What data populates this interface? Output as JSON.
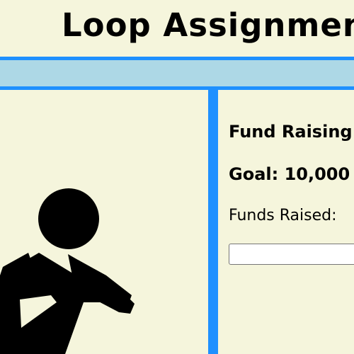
{
  "header": {
    "title": "Loop Assignment"
  },
  "fundraiser": {
    "section_title": "Fund Raising",
    "goal_text": "Goal: 10,000",
    "funds_label": "Funds Raised:",
    "funds_value": ""
  },
  "icons": {
    "runner": "running-person-icon"
  },
  "colors": {
    "background": "#f5f5dc",
    "accent_blue": "#1e90ff",
    "nav_bar": "#add8e6"
  }
}
